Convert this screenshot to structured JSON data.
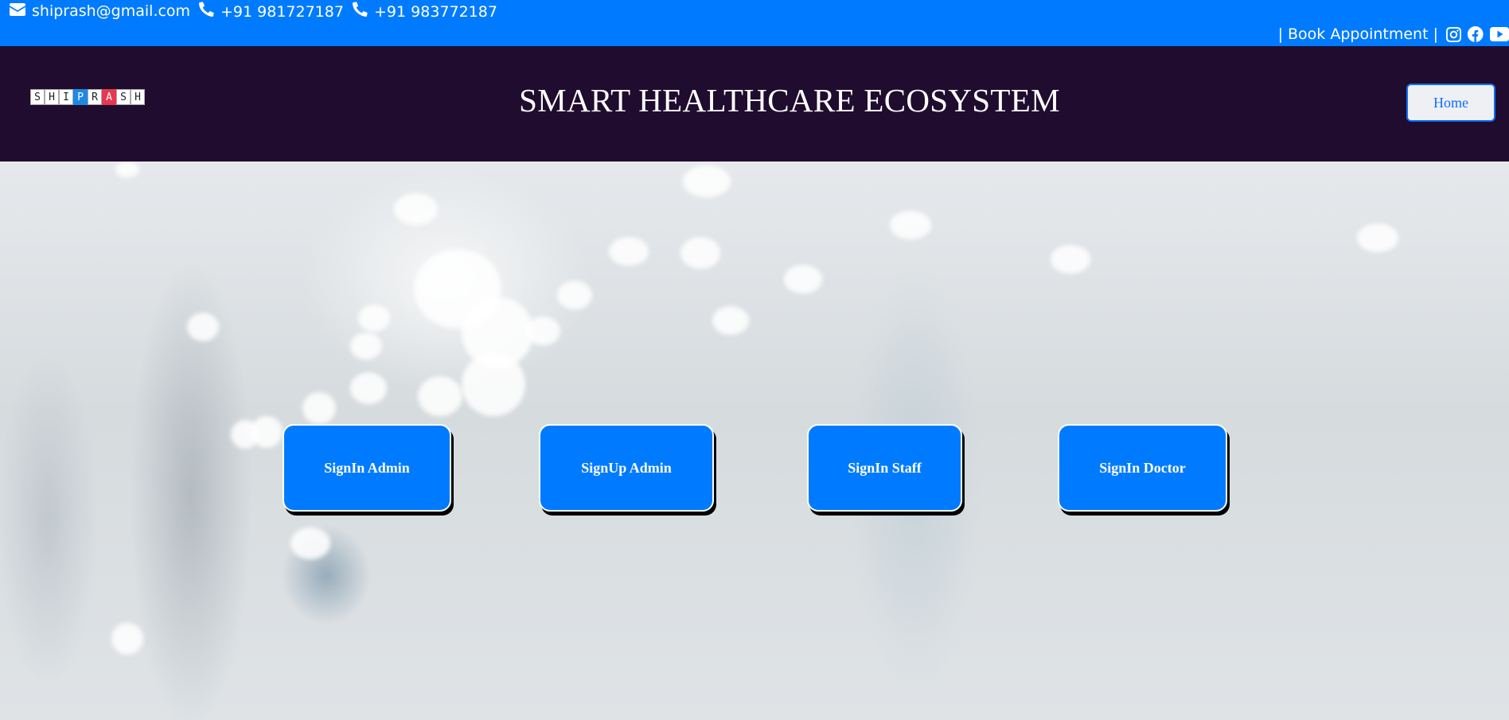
{
  "topbar": {
    "email": "shiprash@gmail.com",
    "phone1": "+91 981727187",
    "phone2": "+91 983772187",
    "book_link": "| Book Appointment |",
    "social_icons": [
      "instagram-icon",
      "facebook-icon",
      "youtube-icon"
    ],
    "background_color": "#007bff"
  },
  "header": {
    "logo_letters": [
      "S",
      "H",
      "I",
      "P",
      "R",
      "A",
      "S",
      "H"
    ],
    "title": "SMART HEALTHCARE ECOSYSTEM",
    "home_label": "Home",
    "background_color": "#200c2f"
  },
  "hero": {
    "buttons": [
      {
        "label": "SignIn Admin"
      },
      {
        "label": "SignUp Admin"
      },
      {
        "label": "SignIn Staff"
      },
      {
        "label": "SignIn Doctor"
      }
    ],
    "button_color": "#007bff"
  }
}
